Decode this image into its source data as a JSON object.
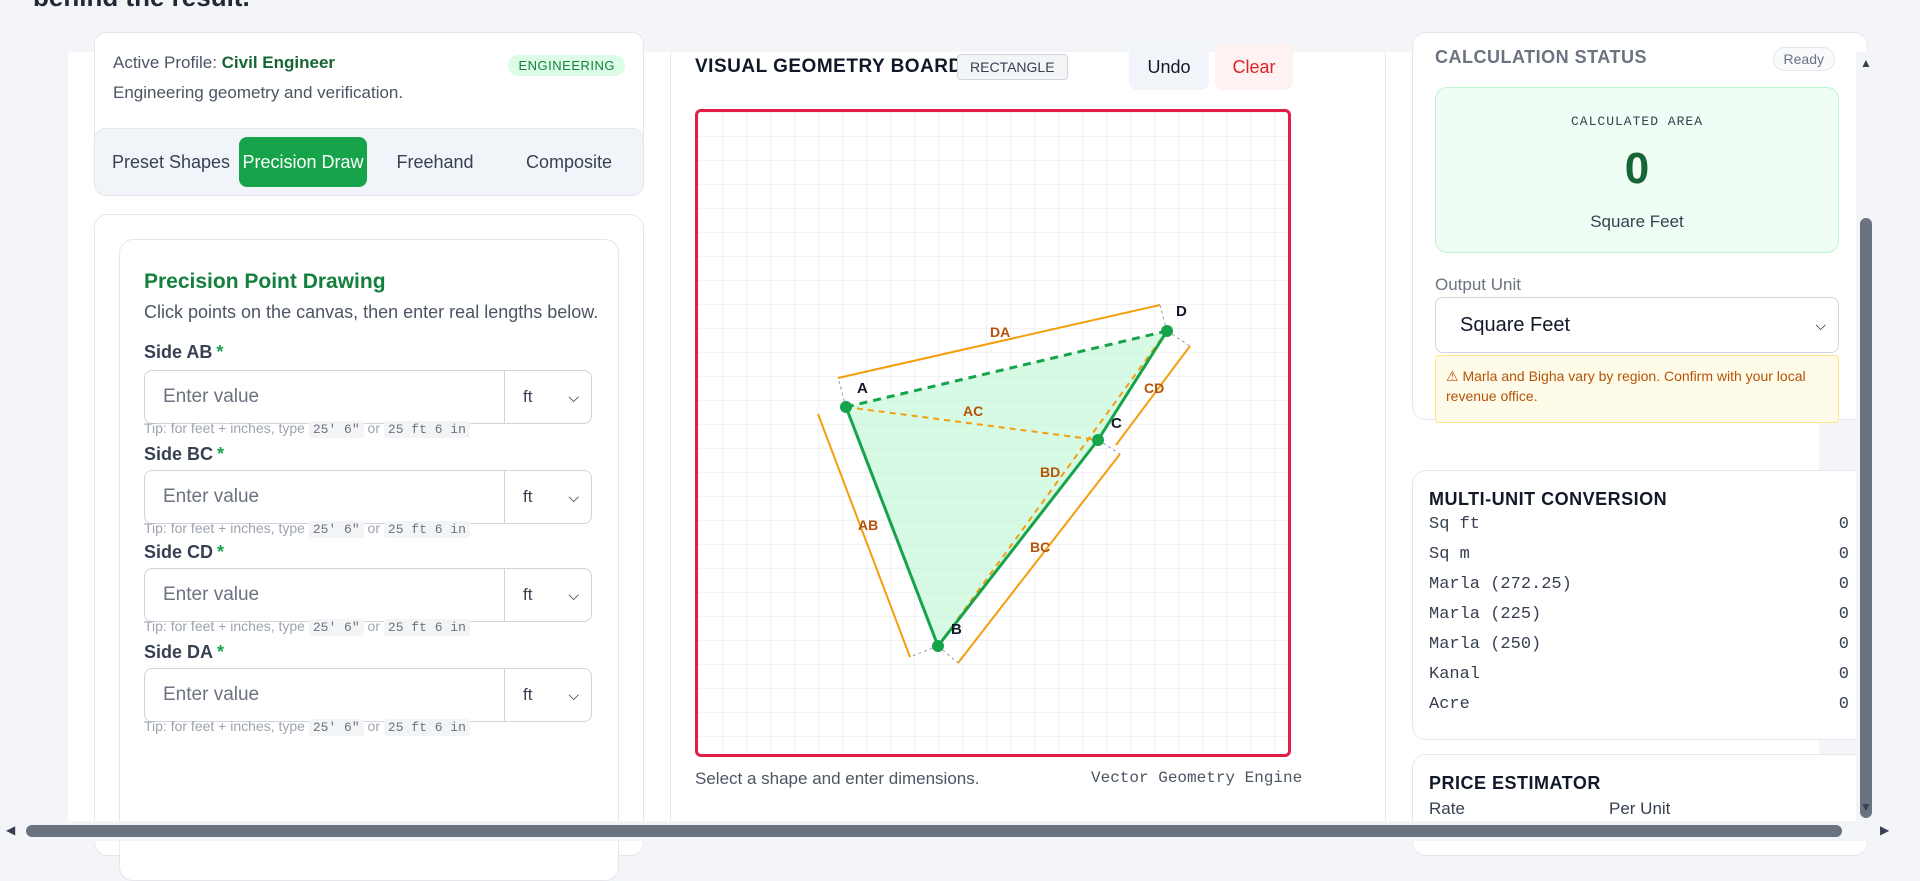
{
  "header": {
    "cut_text": "behind the result."
  },
  "profile": {
    "prefix": "Active Profile: ",
    "name": "Civil Engineer",
    "badge": "ENGINEERING",
    "subtitle": "Engineering geometry and verification."
  },
  "mode_tabs": [
    {
      "label": "Preset Shapes",
      "active": false
    },
    {
      "label": "Precision Draw",
      "active": true
    },
    {
      "label": "Freehand",
      "active": false
    },
    {
      "label": "Composite",
      "active": false
    }
  ],
  "form": {
    "title": "Precision Point Drawing",
    "description": "Click points on the canvas, then enter real lengths below.",
    "tip_prefix": "Tip: for feet + inches, type",
    "tip_example_1": "25' 6\"",
    "tip_or": "or",
    "tip_example_2": "25 ft 6 in",
    "fields": [
      {
        "label": "Side AB",
        "required": "*",
        "placeholder": "Enter value",
        "value": "",
        "unit": "ft"
      },
      {
        "label": "Side BC",
        "required": "*",
        "placeholder": "Enter value",
        "value": "",
        "unit": "ft"
      },
      {
        "label": "Side CD",
        "required": "*",
        "placeholder": "Enter value",
        "value": "",
        "unit": "ft"
      },
      {
        "label": "Side DA",
        "required": "*",
        "placeholder": "Enter value",
        "value": "",
        "unit": "ft"
      }
    ]
  },
  "board": {
    "title": "VISUAL GEOMETRY BOARD",
    "shape_chip": "RECTANGLE",
    "undo_label": "Undo",
    "clear_label": "Clear",
    "footer_left": "Select a shape and enter dimensions.",
    "footer_right": "Vector Geometry Engine",
    "point_labels": [
      "A",
      "B",
      "C",
      "D"
    ],
    "side_labels": [
      "DA",
      "AC",
      "CD",
      "BD",
      "AB",
      "BC"
    ],
    "colors": {
      "border": "#e11d48",
      "polygon_fill": "#bbf7d0",
      "polygon_stroke": "#16a34a",
      "dimension": "#f59e0b",
      "dimension_text": "#b45309"
    }
  },
  "calc": {
    "title": "CALCULATION STATUS",
    "status": "Ready",
    "area_label": "CALCULATED AREA",
    "area_value": "0",
    "area_unit": "Square Feet",
    "output_unit_label": "Output Unit",
    "output_unit_value": "Square Feet",
    "warning": "⚠ Marla and Bigha vary by region. Confirm with your local revenue office."
  },
  "conversion": {
    "title": "MULTI-UNIT CONVERSION",
    "rows": [
      {
        "label": "Sq ft",
        "value": "0"
      },
      {
        "label": "Sq m",
        "value": "0"
      },
      {
        "label": "Marla (272.25)",
        "value": "0"
      },
      {
        "label": "Marla (225)",
        "value": "0"
      },
      {
        "label": "Marla (250)",
        "value": "0"
      },
      {
        "label": "Kanal",
        "value": "0"
      },
      {
        "label": "Acre",
        "value": "0"
      }
    ]
  },
  "price": {
    "title": "PRICE ESTIMATOR",
    "col_rate": "Rate",
    "col_per_unit": "Per Unit"
  },
  "icons": {
    "chevron": "chevron-down-icon",
    "warning": "warning-icon"
  }
}
